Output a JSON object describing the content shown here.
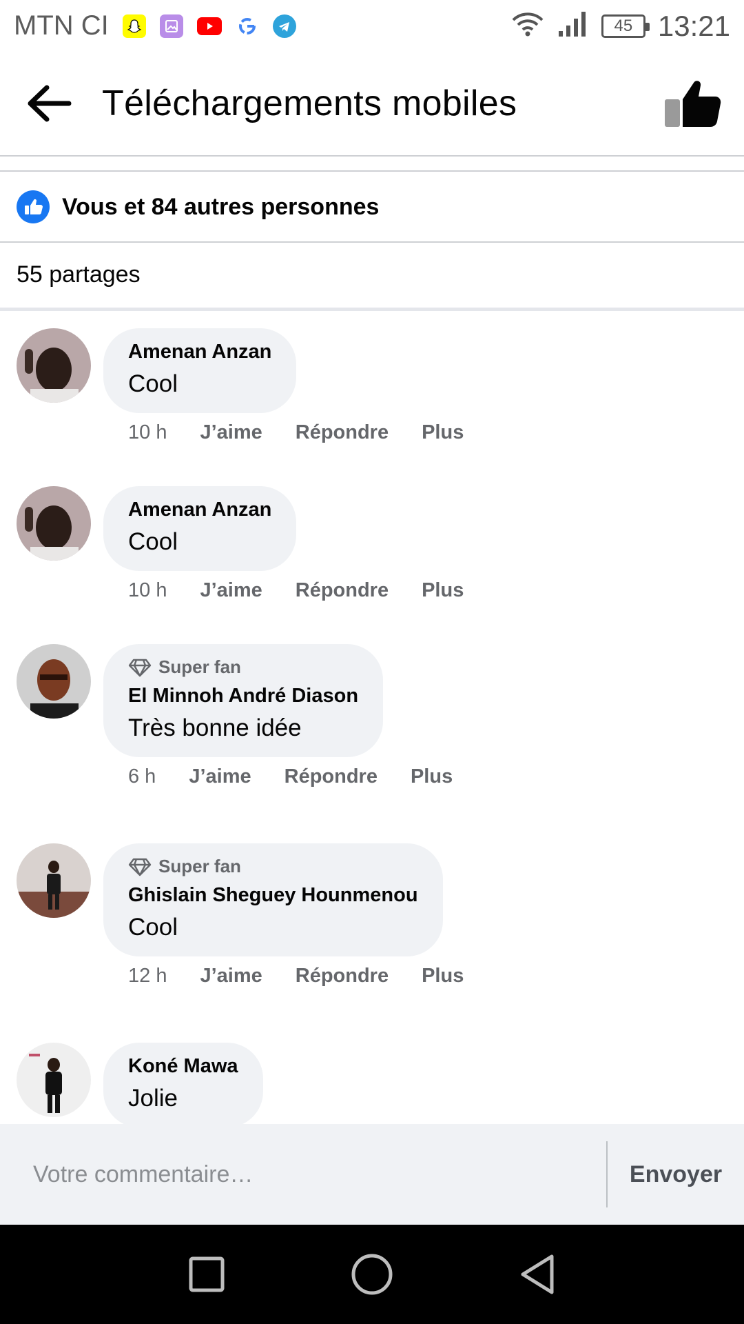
{
  "status_bar": {
    "carrier": "MTN CI",
    "notification_icons": [
      "snapchat-icon",
      "gallery-icon",
      "youtube-icon",
      "google-icon",
      "telegram-icon"
    ],
    "battery": "45",
    "time": "13:21"
  },
  "header": {
    "title": "Téléchargements mobiles",
    "back_icon": "arrow-left-icon",
    "like_icon": "thumbs-up-icon"
  },
  "reactions": {
    "text": "Vous et 84 autres personnes"
  },
  "shares": {
    "text": "55 partages"
  },
  "comments": [
    {
      "author": "Amenan Anzan",
      "text": "Cool",
      "time": "10 h",
      "badge": "",
      "like": "J’aime",
      "reply": "Répondre",
      "more": "Plus"
    },
    {
      "author": "Amenan Anzan",
      "text": "Cool",
      "time": "10 h",
      "badge": "",
      "like": "J’aime",
      "reply": "Répondre",
      "more": "Plus"
    },
    {
      "author": "El Minnoh André Diason",
      "text": "Très bonne idée",
      "time": "6 h",
      "badge": "Super fan",
      "like": "J’aime",
      "reply": "Répondre",
      "more": "Plus"
    },
    {
      "author": "Ghislain Sheguey Hounmenou",
      "text": "Cool",
      "time": "12 h",
      "badge": "Super fan",
      "like": "J’aime",
      "reply": "Répondre",
      "more": "Plus"
    },
    {
      "author": "Koné Mawa",
      "text": "Jolie",
      "time": "",
      "badge": "",
      "like": "",
      "reply": "",
      "more": ""
    }
  ],
  "compose": {
    "placeholder": "Votre commentaire…",
    "send_label": "Envoyer"
  },
  "colors": {
    "accent": "#1877f2",
    "bubble": "#f0f2f5",
    "secondary_text": "#65676b"
  }
}
